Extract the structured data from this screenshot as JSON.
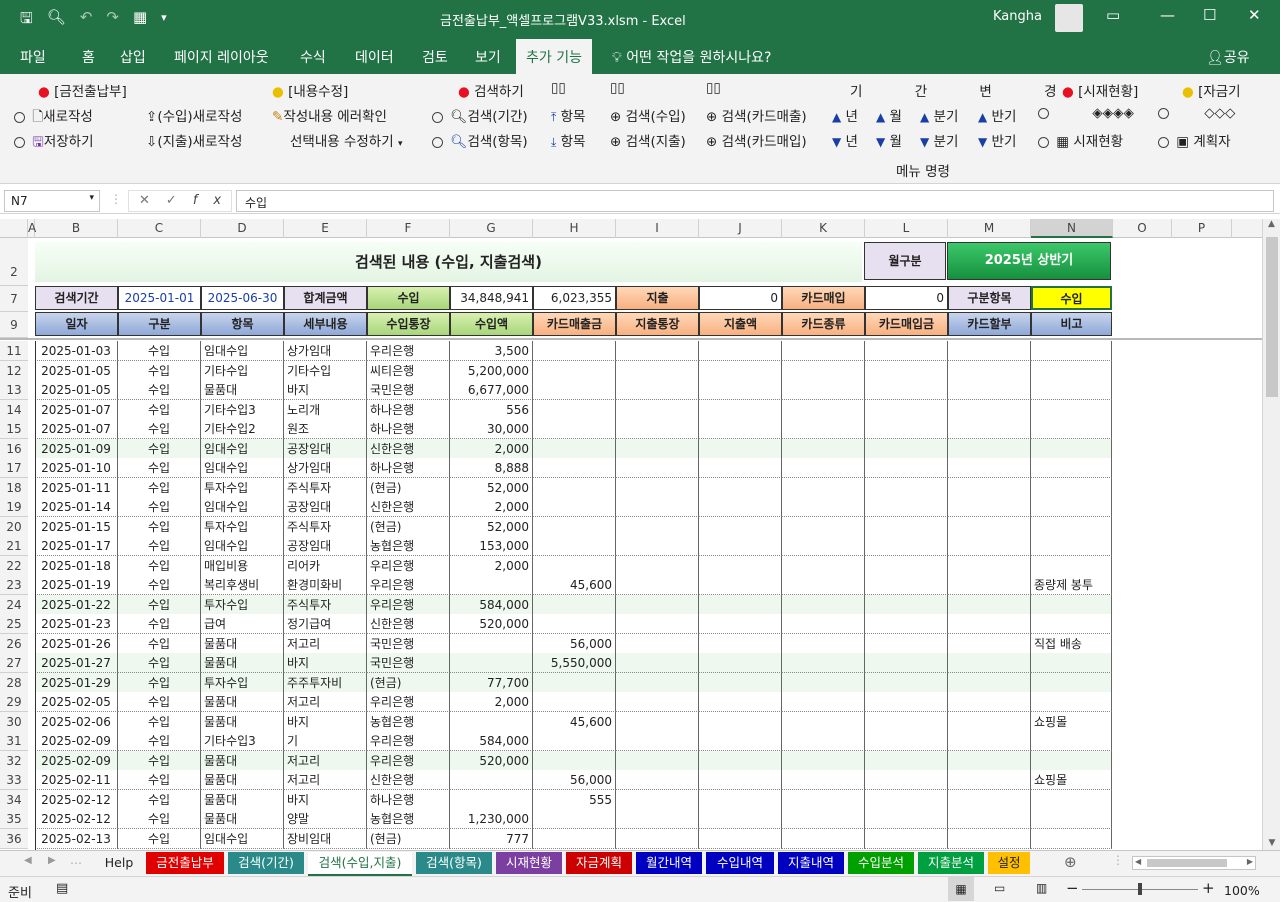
{
  "app": {
    "file_title": "금전출납부_액셀프로그램V33.xlsm - Excel",
    "user": "Kangha"
  },
  "menu": {
    "tabs": [
      "파일",
      "홈",
      "삽입",
      "페이지 레이아웃",
      "수식",
      "데이터",
      "검토",
      "보기",
      "추가 기능"
    ],
    "tell_me": "어떤 작업을 원하시나요?",
    "share": "공유"
  },
  "ribbon": {
    "g1_title": "[금전출납부]",
    "new_doc": "새로작성",
    "save": "저장하기",
    "income_new": "(수입)새로작성",
    "expense_new": "(지출)새로작성",
    "g2_title": "[내용수정]",
    "error_check": "작성내용 에러확인",
    "edit_selected": "선택내용 수정하기",
    "g3_title": "검색하기",
    "search_period": "검색(기간)",
    "search_item": "검색(항목)",
    "item1": "항목",
    "item2": "항목",
    "search_income": "검색(수입)",
    "search_expense": "검색(지출)",
    "search_card_sales": "검색(카드매출)",
    "search_card_buy": "검색(카드매입)",
    "period_label": "기 간 변 경",
    "year_up": "년",
    "month_up": "월",
    "quarter_up": "분기",
    "half_up": "반기",
    "year_down": "년",
    "month_down": "월",
    "quarter_down": "분기",
    "half_down": "반기",
    "g4_title": "[시재현황]",
    "diamonds": "◈◈◈◈",
    "cash_status": "시재현황",
    "g5_title": "[자금기",
    "diamonds2": "◇◇◇",
    "plan": "계획자",
    "group_label": "메뉴 명령"
  },
  "formula": {
    "name_box": "N7",
    "value": "수입"
  },
  "columns": [
    "A",
    "B",
    "C",
    "D",
    "E",
    "F",
    "G",
    "H",
    "I",
    "J",
    "K",
    "L",
    "M",
    "N",
    "O",
    "P"
  ],
  "sheet": {
    "title": "검색된 내용 (수입, 지출검색)",
    "month_label": "월구분",
    "month_value": "2025년 상반기",
    "period_label": "검색기간",
    "date_from": "2025-01-01",
    "date_to": "2025-06-30",
    "total_label": "합계금액",
    "income_label": "수입",
    "income_total": "34,848,941",
    "card_sales_total": "6,023,355",
    "expense_label": "지출",
    "expense_total": "0",
    "card_buy_label": "카드매입",
    "card_buy_total": "0",
    "category_label": "구분항목",
    "category_value": "수입",
    "headers": [
      "일자",
      "구분",
      "항목",
      "세부내용",
      "수입통장",
      "수입액",
      "카드매출금",
      "지출통장",
      "지출액",
      "카드종류",
      "카드매입금",
      "카드할부",
      "비고"
    ],
    "row_numbers": [
      "11",
      "12",
      "13",
      "14",
      "15",
      "16",
      "17",
      "18",
      "19",
      "20",
      "21",
      "22",
      "23",
      "24",
      "25",
      "26",
      "27",
      "28",
      "29",
      "30",
      "31",
      "32",
      "33",
      "34",
      "35",
      "36"
    ],
    "rows": [
      [
        "2025-01-03",
        "수입",
        "임대수입",
        "상가임대",
        "우리은행",
        "3,500",
        "",
        ""
      ],
      [
        "2025-01-05",
        "수입",
        "기타수입",
        "기타수입",
        "씨티은행",
        "5,200,000",
        "",
        ""
      ],
      [
        "2025-01-05",
        "수입",
        "물품대",
        "바지",
        "국민은행",
        "6,677,000",
        "",
        ""
      ],
      [
        "2025-01-07",
        "수입",
        "기타수입3",
        "노리개",
        "하나은행",
        "556",
        "",
        ""
      ],
      [
        "2025-01-07",
        "수입",
        "기타수입2",
        "원조",
        "하나은행",
        "30,000",
        "",
        ""
      ],
      [
        "2025-01-09",
        "수입",
        "임대수입",
        "공장임대",
        "신한은행",
        "2,000",
        "",
        ""
      ],
      [
        "2025-01-10",
        "수입",
        "임대수입",
        "상가임대",
        "하나은행",
        "8,888",
        "",
        ""
      ],
      [
        "2025-01-11",
        "수입",
        "투자수입",
        "주식투자",
        "(현금)",
        "52,000",
        "",
        ""
      ],
      [
        "2025-01-14",
        "수입",
        "임대수입",
        "공장임대",
        "신한은행",
        "2,000",
        "",
        ""
      ],
      [
        "2025-01-15",
        "수입",
        "투자수입",
        "주식투자",
        "(현금)",
        "52,000",
        "",
        ""
      ],
      [
        "2025-01-17",
        "수입",
        "임대수입",
        "공장임대",
        "농협은행",
        "153,000",
        "",
        ""
      ],
      [
        "2025-01-18",
        "수입",
        "매입비용",
        "리어카",
        "우리은행",
        "2,000",
        "",
        ""
      ],
      [
        "2025-01-19",
        "수입",
        "복리후생비",
        "환경미화비",
        "우리은행",
        "",
        "45,600",
        "종량제 봉투"
      ],
      [
        "2025-01-22",
        "수입",
        "투자수입",
        "주식투자",
        "우리은행",
        "584,000",
        "",
        ""
      ],
      [
        "2025-01-23",
        "수입",
        "급여",
        "정기급여",
        "신한은행",
        "520,000",
        "",
        ""
      ],
      [
        "2025-01-26",
        "수입",
        "물품대",
        "저고리",
        "국민은행",
        "",
        "56,000",
        "직접 배송"
      ],
      [
        "2025-01-27",
        "수입",
        "물품대",
        "바지",
        "국민은행",
        "",
        "5,550,000",
        ""
      ],
      [
        "2025-01-29",
        "수입",
        "투자수입",
        "주주투자비",
        "(현금)",
        "77,700",
        "",
        ""
      ],
      [
        "2025-02-05",
        "수입",
        "물품대",
        "저고리",
        "우리은행",
        "2,000",
        "",
        ""
      ],
      [
        "2025-02-06",
        "수입",
        "물품대",
        "바지",
        "농협은행",
        "",
        "45,600",
        "쇼핑몰"
      ],
      [
        "2025-02-09",
        "수입",
        "기타수입3",
        "기",
        "우리은행",
        "584,000",
        "",
        ""
      ],
      [
        "2025-02-09",
        "수입",
        "물품대",
        "저고리",
        "우리은행",
        "520,000",
        "",
        ""
      ],
      [
        "2025-02-11",
        "수입",
        "물품대",
        "저고리",
        "신한은행",
        "",
        "56,000",
        "쇼핑몰"
      ],
      [
        "2025-02-12",
        "수입",
        "물품대",
        "바지",
        "하나은행",
        "",
        "555",
        ""
      ],
      [
        "2025-02-12",
        "수입",
        "물품대",
        "양말",
        "농협은행",
        "1,230,000",
        "",
        ""
      ],
      [
        "2025-02-13",
        "수입",
        "임대수입",
        "장비임대",
        "(현금)",
        "777",
        "",
        ""
      ]
    ]
  },
  "sheet_tabs": [
    {
      "label": "Help",
      "color": "#f3f3f3",
      "fg": "#222"
    },
    {
      "label": "금전출납부",
      "color": "#e00000",
      "fg": "#ffffff"
    },
    {
      "label": "검색(기간)",
      "color": "#2a8a8a",
      "fg": "#ffffff"
    },
    {
      "label": "검색(수입,지출)",
      "color": "#ffffff",
      "fg": "#217346"
    },
    {
      "label": "검색(항목)",
      "color": "#2a8a8a",
      "fg": "#ffffff"
    },
    {
      "label": "시재현황",
      "color": "#7a3fa0",
      "fg": "#ffffff"
    },
    {
      "label": "자금계획",
      "color": "#cc0000",
      "fg": "#ffffff"
    },
    {
      "label": "월간내역",
      "color": "#0000c0",
      "fg": "#ffffff"
    },
    {
      "label": "수입내역",
      "color": "#0000c0",
      "fg": "#ffffff"
    },
    {
      "label": "지출내역",
      "color": "#0000c0",
      "fg": "#ffffff"
    },
    {
      "label": "수입분석",
      "color": "#00a000",
      "fg": "#ffffff"
    },
    {
      "label": "지출분석",
      "color": "#00a040",
      "fg": "#ffffff"
    },
    {
      "label": "설정",
      "color": "#ffc000",
      "fg": "#222222"
    }
  ],
  "status": {
    "ready": "준비",
    "zoom": "100%"
  }
}
